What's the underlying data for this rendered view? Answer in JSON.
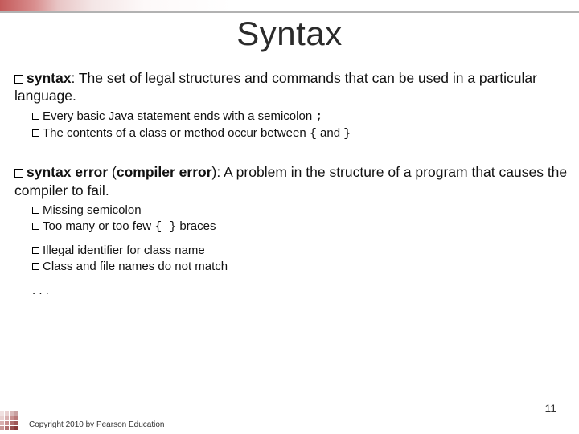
{
  "title": "Syntax",
  "def1": {
    "term": "syntax",
    "text": ": The set of legal structures and commands that can be used in a particular language."
  },
  "sub1a_pre": "Every basic Java statement ends with a semicolon ",
  "sub1a_code": ";",
  "sub1b_pre": "The contents of a class or method occur between ",
  "sub1b_c1": "{",
  "sub1b_mid": " and ",
  "sub1b_c2": "}",
  "def2": {
    "term": "syntax error",
    "paren_label": "compiler error",
    "text": ": A problem in the structure of a program that causes the compiler to fail."
  },
  "sub2a": "Missing semicolon",
  "sub2b_pre": "Too many or too few ",
  "sub2b_c1": "{ }",
  "sub2b_post": " braces",
  "sub2c": "Illegal identifier for class name",
  "sub2d": "Class and file names do not match",
  "ellipsis": ". . .",
  "footer": "Copyright 2010 by Pearson Education",
  "page": "11"
}
